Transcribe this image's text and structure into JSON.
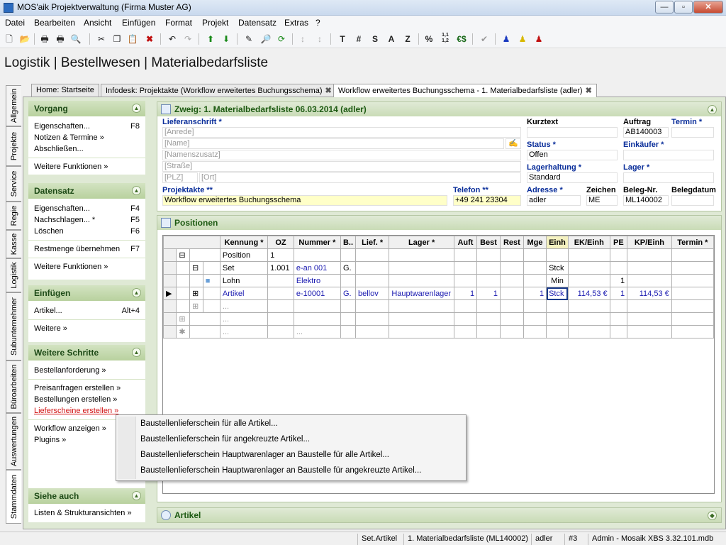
{
  "window": {
    "title": "MOS'aik Projektverwaltung (Firma Muster AG)",
    "min": "—",
    "max": "▫",
    "close": "✕"
  },
  "menu": [
    "Datei",
    "Bearbeiten",
    "Ansicht",
    "Einfügen",
    "Format",
    "Projekt",
    "Datensatz",
    "Extras",
    "?"
  ],
  "toolbar_text": {
    "t": "T",
    "hash": "#",
    "s": "S",
    "a": "A",
    "z": "Z",
    "pct": "%",
    "num": "1,1 1,2",
    "euro": "€$"
  },
  "page_title": "Logistik | Bestellwesen | Materialbedarfsliste",
  "side_tabs": [
    "Allgemein",
    "Projekte",
    "Service",
    "Regie",
    "Kasse",
    "Logistik",
    "Subunternehmer",
    "Büroarbeiten",
    "Auswertungen",
    "Stammdaten"
  ],
  "tabs": [
    {
      "label": "Home: Startseite"
    },
    {
      "label": "Infodesk: Projektakte (Workflow erweitertes Buchungsschema)"
    },
    {
      "label": "Workflow erweitertes Buchungsschema - 1. Materialbedarfsliste (adler)"
    }
  ],
  "left": {
    "vorgang": {
      "title": "Vorgang",
      "items": [
        {
          "label": "Eigenschaften...",
          "key": "F8"
        },
        {
          "label": "Notizen & Termine »",
          "key": ""
        },
        {
          "label": "Abschließen...",
          "key": ""
        }
      ],
      "more": "Weitere Funktionen »"
    },
    "datensatz": {
      "title": "Datensatz",
      "items": [
        {
          "label": "Eigenschaften...",
          "key": "F4"
        },
        {
          "label": "Nachschlagen... *",
          "key": "F5"
        },
        {
          "label": "Löschen",
          "key": "F6"
        }
      ],
      "restmenge": "Restmenge übernehmen",
      "restmenge_key": "F7",
      "more": "Weitere Funktionen »"
    },
    "einfuegen": {
      "title": "Einfügen",
      "artikel": "Artikel...",
      "artikel_key": "Alt+4",
      "more": "Weitere »"
    },
    "schritte": {
      "title": "Weitere Schritte",
      "items": [
        "Bestellanforderung »",
        "Preisanfragen erstellen »",
        "Bestellungen erstellen »",
        "Lieferscheine erstellen »",
        "Workflow anzeigen »",
        "Plugins »"
      ]
    },
    "siehe": {
      "title": "Siehe auch",
      "item": "Listen & Strukturansichten »"
    }
  },
  "header_panel": {
    "title": "Zweig: 1. Materialbedarfsliste 06.03.2014 (adler)",
    "lieferanschrift_label": "Lieferanschrift *",
    "ph": {
      "anrede": "[Anrede]",
      "name": "[Name]",
      "namenszusatz": "[Namenszusatz]",
      "strasse": "[Straße]",
      "plz": "[PLZ]",
      "ort": "[Ort]"
    },
    "kurztext_label": "Kurztext",
    "auftrag_label": "Auftrag",
    "auftrag": "AB140003",
    "termin_label": "Termin *",
    "status_label": "Status *",
    "status": "Offen",
    "einkaeufer_label": "Einkäufer *",
    "lagerhaltung_label": "Lagerhaltung *",
    "lagerhaltung": "Standard",
    "lager_label": "Lager *",
    "projektakte_label": "Projektakte **",
    "projektakte": "Workflow erweitertes Buchungsschema",
    "telefon_label": "Telefon **",
    "telefon": "+49 241 23304",
    "adresse_label": "Adresse *",
    "adresse": "adler",
    "zeichen_label": "Zeichen",
    "zeichen": "ME",
    "belegnr_label": "Beleg-Nr.",
    "belegnr": "ML140002",
    "belegdatum_label": "Belegdatum"
  },
  "positionen": {
    "title": "Positionen",
    "columns": [
      "Kennung *",
      "OZ",
      "Nummer *",
      "B..",
      "Lief. *",
      "Lager *",
      "Auft",
      "Best",
      "Rest",
      "Mge",
      "Einh",
      "EK/Einh",
      "PE",
      "KP/Einh",
      "Termin *"
    ],
    "rows": [
      {
        "kennung": "Position",
        "oz": "1",
        "nummer": "",
        "b": "",
        "lief": "",
        "lager": "",
        "auft": "",
        "best": "",
        "rest": "",
        "mge": "",
        "einh": "",
        "ek": "",
        "pe": "",
        "kp": ""
      },
      {
        "kennung": "Set",
        "oz": "1.001",
        "nummer": "e-an 001",
        "b": "G.",
        "lief": "",
        "lager": "",
        "auft": "",
        "best": "",
        "rest": "",
        "mge": "",
        "einh": "Stck",
        "ek": "",
        "pe": "",
        "kp": ""
      },
      {
        "kennung": "Lohn",
        "oz": "",
        "nummer": "Elektro",
        "b": "",
        "lief": "",
        "lager": "",
        "auft": "",
        "best": "",
        "rest": "",
        "mge": "",
        "einh": "Min",
        "ek": "",
        "pe": "1",
        "kp": ""
      },
      {
        "kennung": "Artikel",
        "oz": "",
        "nummer": "e-10001",
        "b": "G.",
        "lief": "bellov",
        "lager": "Hauptwarenlager",
        "auft": "1",
        "best": "1",
        "rest": "",
        "mge": "1",
        "einh": "Stck",
        "ek": "114,53 €",
        "pe": "1",
        "kp": "114,53 €"
      },
      {
        "kennung": "...",
        "oz": "",
        "nummer": "",
        "b": "",
        "lief": "",
        "lager": "",
        "auft": "",
        "best": "",
        "rest": "",
        "mge": "",
        "einh": "",
        "ek": "",
        "pe": "",
        "kp": ""
      },
      {
        "kennung": "...",
        "oz": "",
        "nummer": "",
        "b": "",
        "lief": "",
        "lager": "",
        "auft": "",
        "best": "",
        "rest": "",
        "mge": "",
        "einh": "",
        "ek": "",
        "pe": "",
        "kp": ""
      },
      {
        "kennung": "...",
        "oz": "",
        "nummer": "...",
        "b": "",
        "lief": "",
        "lager": "",
        "auft": "",
        "best": "",
        "rest": "",
        "mge": "",
        "einh": "",
        "ek": "",
        "pe": "",
        "kp": ""
      }
    ]
  },
  "context_menu": [
    "Baustellenlieferschein für alle Artikel...",
    "Baustellenlieferschein für angekreuzte Artikel...",
    "Baustellenlieferschein Hauptwarenlager an Baustelle für alle Artikel...",
    "Baustellenlieferschein Hauptwarenlager an Baustelle für angekreuzte Artikel..."
  ],
  "artikel_panel": {
    "title": "Artikel"
  },
  "status": [
    "Set.Artikel",
    "1. Materialbedarfsliste (ML140002)",
    "adler",
    "#3",
    "Admin - Mosaik XBS 3.32.101.mdb"
  ],
  "colors": {
    "accent_green": "#1d5a12",
    "link_blue": "#0a2e9a",
    "highlight_red": "#d01010"
  }
}
